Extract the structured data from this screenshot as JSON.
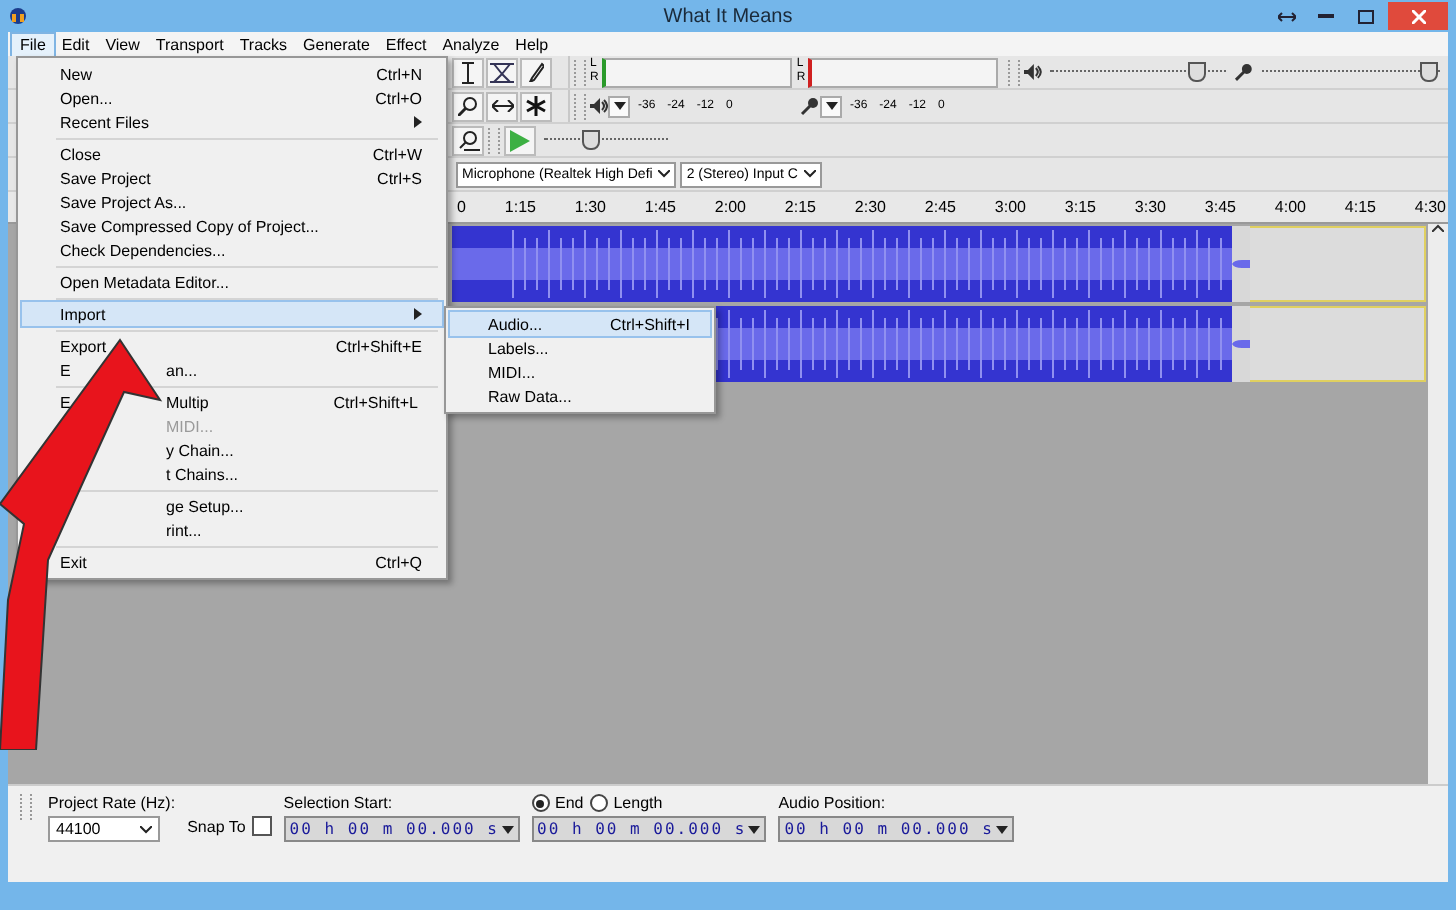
{
  "window": {
    "title": "What It Means"
  },
  "menubar": [
    {
      "label": "File",
      "selected": true
    },
    {
      "label": "Edit",
      "selected": false
    },
    {
      "label": "View",
      "selected": false
    },
    {
      "label": "Transport",
      "selected": false
    },
    {
      "label": "Tracks",
      "selected": false
    },
    {
      "label": "Generate",
      "selected": false
    },
    {
      "label": "Effect",
      "selected": false
    },
    {
      "label": "Analyze",
      "selected": false
    },
    {
      "label": "Help",
      "selected": false
    }
  ],
  "file_menu": [
    {
      "kind": "item",
      "label": "New",
      "shortcut": "Ctrl+N",
      "selected": false,
      "disabled": false
    },
    {
      "kind": "item",
      "label": "Open...",
      "shortcut": "Ctrl+O",
      "selected": false,
      "disabled": false
    },
    {
      "kind": "submenu",
      "label": "Recent Files",
      "selected": false,
      "disabled": false
    },
    {
      "kind": "separator"
    },
    {
      "kind": "item",
      "label": "Close",
      "shortcut": "Ctrl+W",
      "selected": false,
      "disabled": false
    },
    {
      "kind": "item",
      "label": "Save Project",
      "shortcut": "Ctrl+S",
      "selected": false,
      "disabled": false
    },
    {
      "kind": "item",
      "label": "Save Project As...",
      "selected": false,
      "disabled": false
    },
    {
      "kind": "item",
      "label": "Save Compressed Copy of Project...",
      "selected": false,
      "disabled": false
    },
    {
      "kind": "item",
      "label": "Check Dependencies...",
      "selected": false,
      "disabled": false
    },
    {
      "kind": "separator"
    },
    {
      "kind": "item",
      "label": "Open Metadata Editor...",
      "selected": false,
      "disabled": false
    },
    {
      "kind": "separator"
    },
    {
      "kind": "submenu",
      "label": "Import",
      "selected": true,
      "disabled": false
    },
    {
      "kind": "separator"
    },
    {
      "kind": "item",
      "label": "Export",
      "shortcut": "Ctrl+Shift+E",
      "selected": false,
      "disabled": false
    },
    {
      "kind": "partial",
      "lead": "E",
      "label": "an...",
      "selected": false,
      "disabled": false
    },
    {
      "kind": "separator"
    },
    {
      "kind": "partial",
      "lead": "E",
      "label": "Multip",
      "shortcut": "Ctrl+Shift+L",
      "selected": false,
      "disabled": false
    },
    {
      "kind": "partial",
      "label": "MIDI...",
      "selected": false,
      "disabled": true
    },
    {
      "kind": "partial",
      "label": "y Chain...",
      "selected": false,
      "disabled": false
    },
    {
      "kind": "partial",
      "label": "t Chains...",
      "selected": false,
      "disabled": false
    },
    {
      "kind": "separator"
    },
    {
      "kind": "partial",
      "label": "ge Setup...",
      "selected": false,
      "disabled": false
    },
    {
      "kind": "partial",
      "label": "rint...",
      "selected": false,
      "disabled": false
    },
    {
      "kind": "separator"
    },
    {
      "kind": "item",
      "label": "Exit",
      "shortcut": "Ctrl+Q",
      "selected": false,
      "disabled": false
    }
  ],
  "import_submenu": [
    {
      "label": "Audio...",
      "shortcut": "Ctrl+Shift+I",
      "selected": true
    },
    {
      "label": "Labels...",
      "selected": false
    },
    {
      "label": "MIDI...",
      "selected": false
    },
    {
      "label": "Raw Data...",
      "selected": false
    }
  ],
  "meters": [
    {
      "kind": "playback",
      "channels": [
        "L",
        "R"
      ],
      "scale": [
        "-36",
        "-24",
        "-12",
        "0"
      ]
    },
    {
      "kind": "recording",
      "channels": [
        "L",
        "R"
      ],
      "scale": [
        "-36",
        "-24",
        "-12",
        "0"
      ]
    }
  ],
  "mixer": {
    "output_level": {
      "level": 0.82
    },
    "input_level": {
      "level": 0.92
    }
  },
  "play_speed": {
    "level": 0.35
  },
  "device_selects": [
    "Microphone (Realtek High Defi",
    "2 (Stereo) Input C"
  ],
  "timeline": [
    "0",
    "1:15",
    "1:30",
    "1:45",
    "2:00",
    "2:15",
    "2:30",
    "2:45",
    "3:00",
    "3:15",
    "3:30",
    "3:45",
    "4:00",
    "4:15",
    "4:30"
  ],
  "selection_bar": {
    "rate_label": "Project Rate (Hz):",
    "rate": "44100",
    "snap_label": "Snap To",
    "snap_checked": false,
    "start_label": "Selection Start:",
    "radios": [
      {
        "label": "End",
        "selected": true
      },
      {
        "label": "Length",
        "selected": false
      }
    ],
    "position_label": "Audio Position:",
    "times": [
      "00 h 00 m 00.000 s",
      "00 h 00 m 00.000 s",
      "00 h 00 m 00.000 s"
    ]
  }
}
